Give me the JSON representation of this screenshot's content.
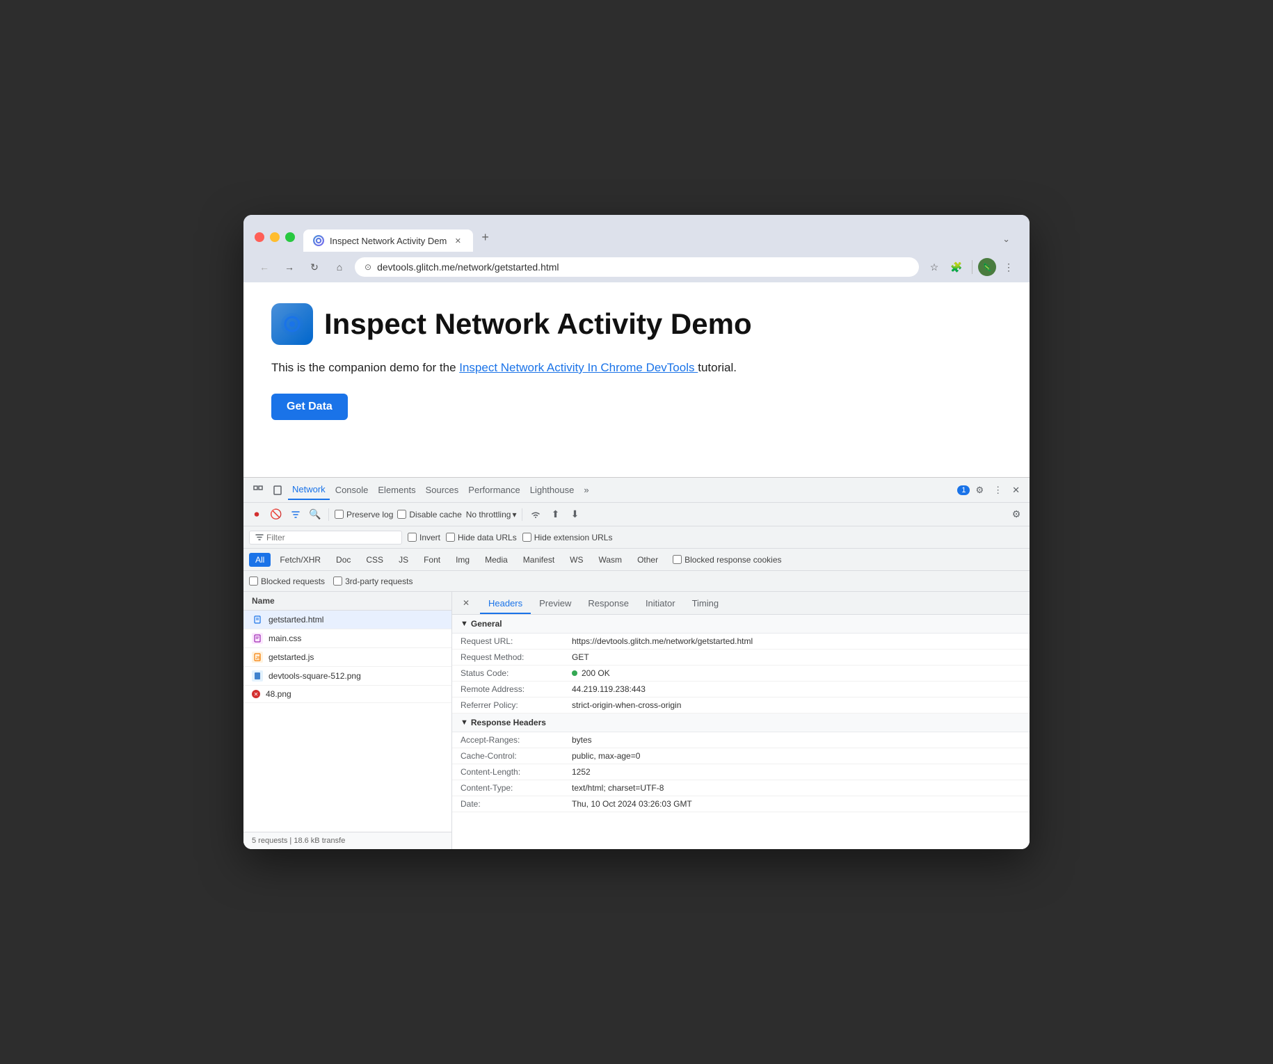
{
  "browser": {
    "tab_title": "Inspect Network Activity Dem",
    "tab_favicon": "🔵",
    "url": "devtools.glitch.me/network/getstarted.html",
    "new_tab_label": "+",
    "tab_menu_label": "⌄",
    "back_disabled": true,
    "forward_disabled": true
  },
  "page": {
    "logo_icon": "⊙",
    "title": "Inspect Network Activity Demo",
    "subtitle_prefix": "This is the companion demo for the ",
    "subtitle_link": "Inspect Network Activity In Chrome DevTools ",
    "subtitle_suffix": "tutorial.",
    "get_data_label": "Get Data"
  },
  "devtools": {
    "tabs": [
      {
        "label": "Network",
        "active": true
      },
      {
        "label": "Console"
      },
      {
        "label": "Elements"
      },
      {
        "label": "Sources"
      },
      {
        "label": "Performance"
      },
      {
        "label": "Lighthouse"
      },
      {
        "label": "»"
      }
    ],
    "badge_count": "1",
    "toolbar": {
      "record_tooltip": "Stop recording",
      "clear_tooltip": "Clear",
      "filter_tooltip": "Filter",
      "search_tooltip": "Search",
      "preserve_log": "Preserve log",
      "disable_cache": "Disable cache",
      "throttle": "No throttling",
      "settings_tooltip": "Settings"
    },
    "filter_bar": {
      "placeholder": "Filter",
      "invert_label": "Invert",
      "hide_data_urls": "Hide data URLs",
      "hide_ext_urls": "Hide extension URLs"
    },
    "type_buttons": [
      {
        "label": "All",
        "active": true
      },
      {
        "label": "Fetch/XHR"
      },
      {
        "label": "Doc"
      },
      {
        "label": "CSS"
      },
      {
        "label": "JS"
      },
      {
        "label": "Font"
      },
      {
        "label": "Img"
      },
      {
        "label": "Media"
      },
      {
        "label": "Manifest"
      },
      {
        "label": "WS"
      },
      {
        "label": "Wasm"
      },
      {
        "label": "Other"
      }
    ],
    "blocked_response_cookies": "Blocked response cookies",
    "blocked_requests": "Blocked requests",
    "third_party_requests": "3rd-party requests",
    "files": [
      {
        "name": "getstarted.html",
        "type": "html",
        "selected": true
      },
      {
        "name": "main.css",
        "type": "css"
      },
      {
        "name": "getstarted.js",
        "type": "js"
      },
      {
        "name": "devtools-square-512.png",
        "type": "png-blue"
      },
      {
        "name": "48.png",
        "type": "png-red",
        "error": true
      }
    ],
    "file_list_header": "Name",
    "footer": "5 requests | 18.6 kB transfe",
    "details_tabs": [
      {
        "label": "Headers",
        "active": true
      },
      {
        "label": "Preview"
      },
      {
        "label": "Response"
      },
      {
        "label": "Initiator"
      },
      {
        "label": "Timing"
      }
    ],
    "general_section": {
      "title": "General",
      "rows": [
        {
          "key": "Request URL:",
          "value": "https://devtools.glitch.me/network/getstarted.html"
        },
        {
          "key": "Request Method:",
          "value": "GET"
        },
        {
          "key": "Status Code:",
          "value": "200 OK",
          "status": true
        },
        {
          "key": "Remote Address:",
          "value": "44.219.119.238:443"
        },
        {
          "key": "Referrer Policy:",
          "value": "strict-origin-when-cross-origin"
        }
      ]
    },
    "response_headers_section": {
      "title": "Response Headers",
      "rows": [
        {
          "key": "Accept-Ranges:",
          "value": "bytes"
        },
        {
          "key": "Cache-Control:",
          "value": "public, max-age=0"
        },
        {
          "key": "Content-Length:",
          "value": "1252"
        },
        {
          "key": "Content-Type:",
          "value": "text/html; charset=UTF-8"
        },
        {
          "key": "Date:",
          "value": "Thu, 10 Oct 2024 03:26:03 GMT"
        }
      ]
    }
  }
}
